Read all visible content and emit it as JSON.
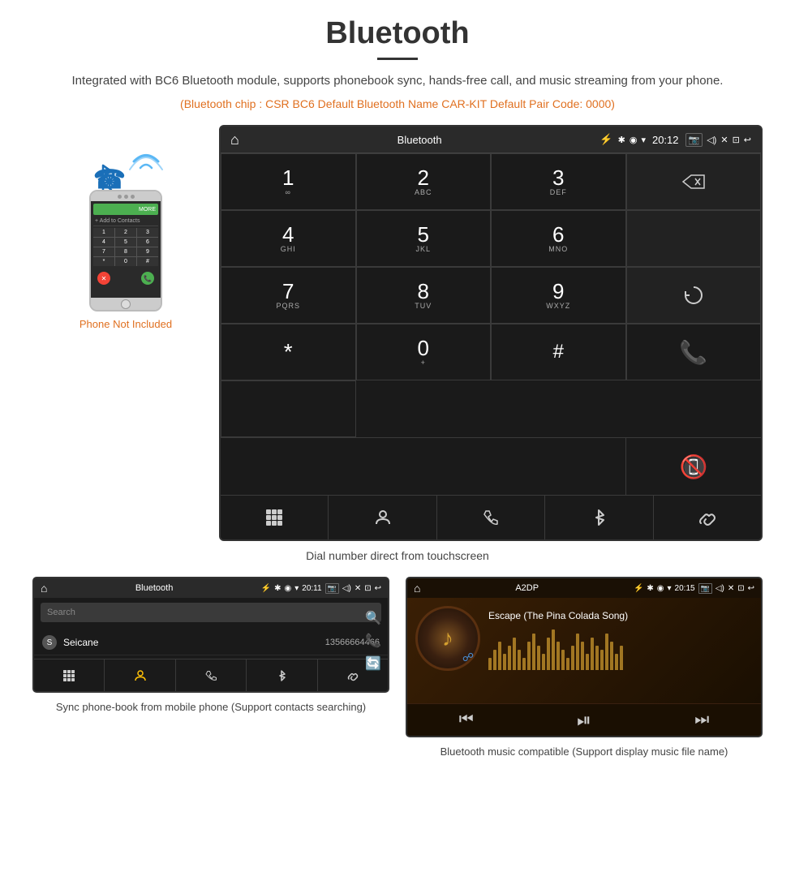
{
  "page": {
    "title": "Bluetooth",
    "description": "Integrated with BC6 Bluetooth module, supports phonebook sync, hands-free call, and music streaming from your phone.",
    "specs": "(Bluetooth chip : CSR BC6    Default Bluetooth Name CAR-KIT    Default Pair Code: 0000)",
    "dialpad_caption": "Dial number direct from touchscreen",
    "phone_not_included": "Phone Not Included"
  },
  "car_screen": {
    "statusbar": {
      "home_icon": "⌂",
      "title": "Bluetooth",
      "usb_icon": "✦",
      "time": "20:12",
      "bt_icon": "✱",
      "location_icon": "◉",
      "signal_icon": "▼",
      "camera_icon": "◻",
      "volume_icon": "◁",
      "close_icon": "✕",
      "window_icon": "⊡",
      "back_icon": "↩"
    },
    "dialpad": [
      {
        "num": "1",
        "letters": "∞"
      },
      {
        "num": "2",
        "letters": "ABC"
      },
      {
        "num": "3",
        "letters": "DEF"
      },
      {
        "num": "",
        "letters": "",
        "type": "backspace"
      },
      {
        "num": "4",
        "letters": "GHI"
      },
      {
        "num": "5",
        "letters": "JKL"
      },
      {
        "num": "6",
        "letters": "MNO"
      },
      {
        "num": "",
        "letters": "",
        "type": "empty"
      },
      {
        "num": "7",
        "letters": "PQRS"
      },
      {
        "num": "8",
        "letters": "TUV"
      },
      {
        "num": "9",
        "letters": "WXYZ"
      },
      {
        "num": "",
        "letters": "",
        "type": "refresh"
      },
      {
        "num": "*",
        "letters": ""
      },
      {
        "num": "0",
        "letters": "+"
      },
      {
        "num": "#",
        "letters": ""
      },
      {
        "num": "",
        "letters": "",
        "type": "call-green"
      },
      {
        "num": "",
        "letters": "",
        "type": "call-red"
      }
    ],
    "toolbar": [
      "⊞",
      "👤",
      "📞",
      "✱",
      "🔗"
    ]
  },
  "contacts_screen": {
    "statusbar_title": "Bluetooth",
    "time": "20:11",
    "search_placeholder": "Search",
    "contact": {
      "letter": "S",
      "name": "Seicane",
      "number": "13566664466"
    },
    "toolbar_icons": [
      "⊞",
      "👤",
      "📞",
      "✱",
      "🔗"
    ]
  },
  "music_screen": {
    "statusbar_title": "A2DP",
    "time": "20:15",
    "song_title": "Escape (The Pina Colada Song)",
    "controls": [
      "⏮",
      "⏯",
      "⏭"
    ],
    "wave_heights": [
      15,
      25,
      35,
      20,
      30,
      40,
      25,
      15,
      35,
      45,
      30,
      20,
      40,
      50,
      35,
      25,
      15,
      30,
      45,
      35,
      20,
      40,
      30,
      25,
      45,
      35,
      20,
      30
    ]
  },
  "captions": {
    "contacts_caption": "Sync phone-book from mobile phone\n(Support contacts searching)",
    "music_caption": "Bluetooth music compatible\n(Support display music file name)"
  }
}
